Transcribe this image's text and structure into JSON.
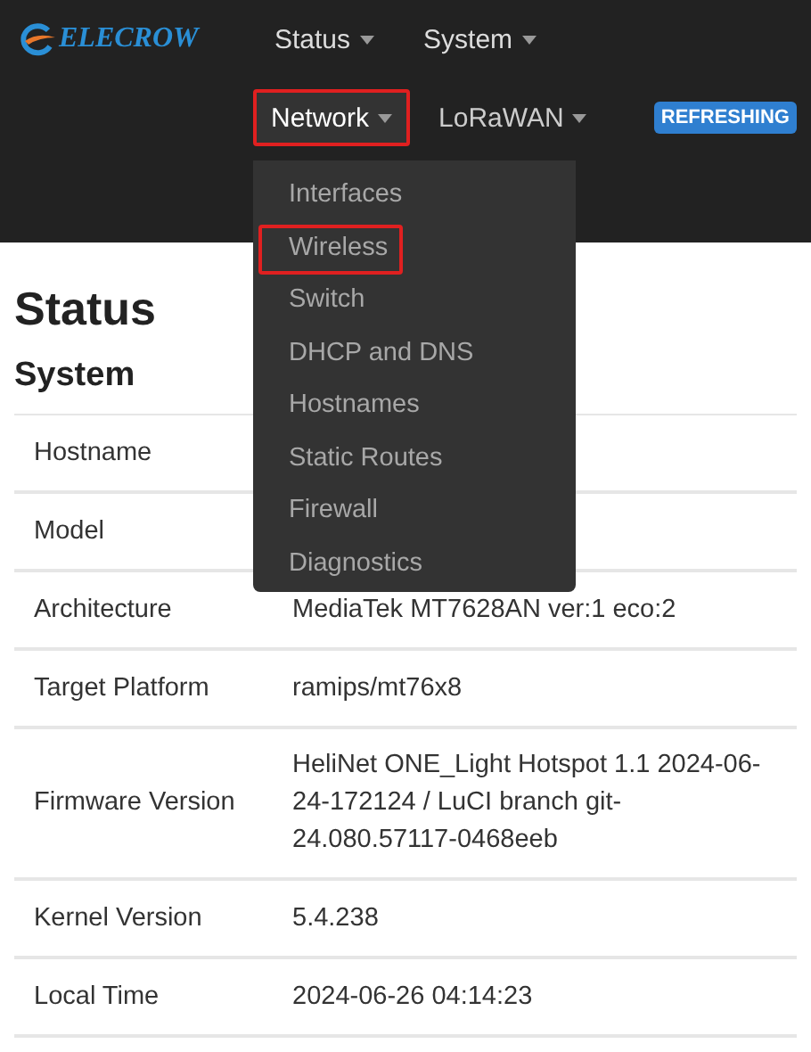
{
  "header": {
    "logo_text": "ELECROW",
    "nav_top": [
      {
        "label": "Status",
        "highlighted": false
      },
      {
        "label": "System",
        "highlighted": false
      }
    ],
    "nav_second": [
      {
        "label": "Network",
        "highlighted": true,
        "expanded": true
      },
      {
        "label": "LoRaWAN",
        "highlighted": false,
        "expanded": false
      }
    ],
    "badge": "REFRESHING"
  },
  "dropdown": {
    "items": [
      {
        "label": "Interfaces",
        "highlighted": false
      },
      {
        "label": "Wireless",
        "highlighted": true
      },
      {
        "label": "Switch",
        "highlighted": false
      },
      {
        "label": "DHCP and DNS",
        "highlighted": false
      },
      {
        "label": "Hostnames",
        "highlighted": false
      },
      {
        "label": "Static Routes",
        "highlighted": false
      },
      {
        "label": "Firewall",
        "highlighted": false
      },
      {
        "label": "Diagnostics",
        "highlighted": false
      }
    ]
  },
  "page_title": "Status",
  "section_title": "System",
  "table": {
    "rows": [
      {
        "label": "Hostname"
      },
      {
        "label": "Model"
      },
      {
        "label": "Architecture",
        "value": "MediaTek MT7628AN ver:1 eco:2"
      },
      {
        "label": "Target Platform",
        "value": "ramips/mt76x8"
      },
      {
        "label": "Firmware Version",
        "value": "HeliNet ONE_Light Hotspot 1.1 2024-06-24-172124 / LuCI branch git-24.080.57117-0468eeb"
      },
      {
        "label": "Kernel Version",
        "value": "5.4.238"
      },
      {
        "label": "Local Time",
        "value": "2024-06-26 04:14:23"
      }
    ]
  }
}
